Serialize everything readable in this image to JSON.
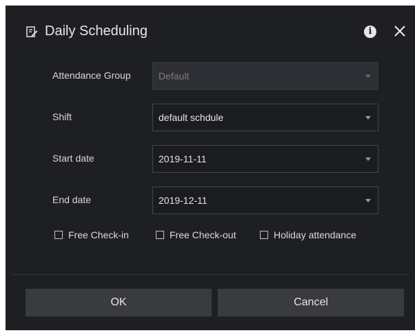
{
  "dialog": {
    "title": "Daily Scheduling",
    "title_icon": "edit-note-icon",
    "info_icon": "info-icon",
    "close_icon": "close-icon"
  },
  "form": {
    "attendance_group": {
      "label": "Attendance Group",
      "value": "Default",
      "disabled": true
    },
    "shift": {
      "label": "Shift",
      "value": "default schdule"
    },
    "start_date": {
      "label": "Start date",
      "value": "2019-11-11"
    },
    "end_date": {
      "label": "End date",
      "value": "2019-12-11"
    }
  },
  "checkboxes": [
    {
      "label": "Free Check-in",
      "checked": false
    },
    {
      "label": "Free Check-out",
      "checked": false
    },
    {
      "label": "Holiday attendance",
      "checked": false
    }
  ],
  "buttons": {
    "ok": "OK",
    "cancel": "Cancel"
  },
  "colors": {
    "dialog_background": "#1e1f23",
    "input_background": "#1b1c20",
    "disabled_input_background": "#2e2f34",
    "button_background": "#3a3b40",
    "text": "#e6e6e6"
  }
}
